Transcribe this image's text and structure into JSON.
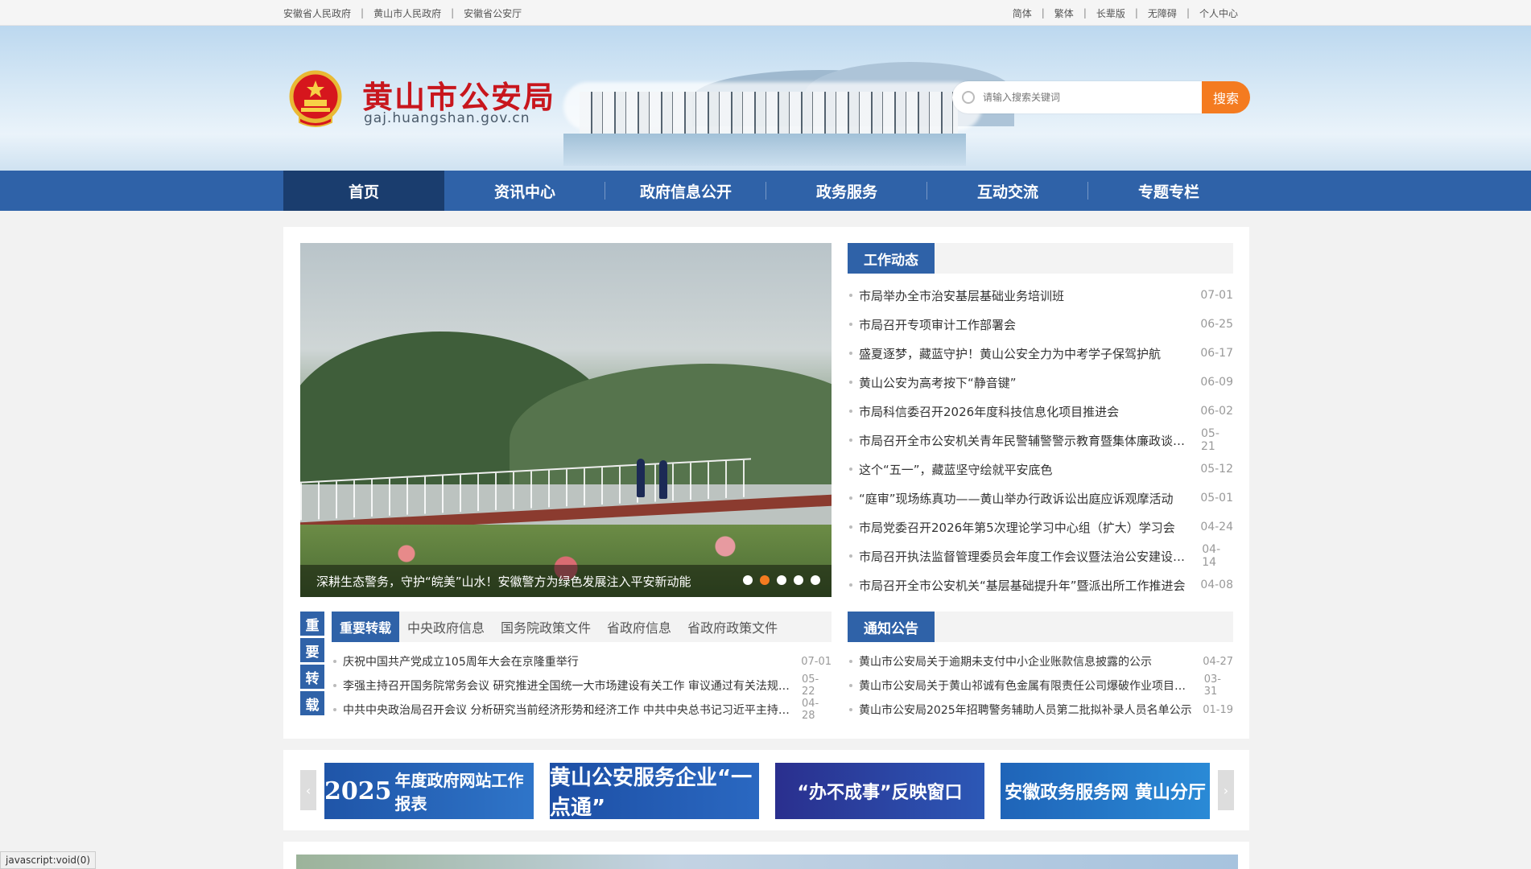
{
  "topbar": {
    "links_left": [
      "安徽省人民政府",
      "黄山市人民政府",
      "安徽省公安厅"
    ],
    "links_right": [
      "简体",
      "繁体",
      "长辈版",
      "无障碍",
      "个人中心"
    ]
  },
  "header": {
    "title": "黄山市公安局",
    "domain": "gaj.huangshan.gov.cn",
    "search_placeholder": "请输入搜索关键词",
    "search_button": "搜索"
  },
  "nav": [
    "首页",
    "资讯中心",
    "政府信息公开",
    "政务服务",
    "互动交流",
    "专题专栏"
  ],
  "slider": {
    "caption": "深耕生态警务，守护“皖美”山水！安徽警方为绿色发展注入平安新动能",
    "dots": 5,
    "active_dot": 1
  },
  "work_news": {
    "tab": "工作动态",
    "items": [
      {
        "title": "市局举办全市治安基层基础业务培训班",
        "date": "07-01"
      },
      {
        "title": "市局召开专项审计工作部署会",
        "date": "06-25"
      },
      {
        "title": "盛夏逐梦，藏蓝守护！黄山公安全力为中考学子保驾护航",
        "date": "06-17"
      },
      {
        "title": "黄山公安为高考按下“静音键”",
        "date": "06-09"
      },
      {
        "title": "市局科信委召开2026年度科技信息化项目推进会",
        "date": "06-02"
      },
      {
        "title": "市局召开全市公安机关青年民警辅警警示教育暨集体廉政谈话会",
        "date": "05-21"
      },
      {
        "title": "这个“五一”，藏蓝坚守绘就平安底色",
        "date": "05-12"
      },
      {
        "title": "“庭审”现场练真功——黄山举办行政诉讼出庭应诉观摩活动",
        "date": "05-01"
      },
      {
        "title": "市局党委召开2026年第5次理论学习中心组（扩大）学习会",
        "date": "04-24"
      },
      {
        "title": "市局召开执法监督管理委员会年度工作会议暨法治公安建设推进会",
        "date": "04-14"
      },
      {
        "title": "市局召开全市公安机关“基层基础提升年”暨派出所工作推进会",
        "date": "04-08"
      }
    ]
  },
  "reprint": {
    "vertical_label": [
      "重",
      "要",
      "转",
      "载"
    ],
    "tabs": [
      "重要转载",
      "中央政府信息",
      "国务院政策文件",
      "省政府信息",
      "省政府政策文件"
    ],
    "items": [
      {
        "title": "庆祝中国共产党成立105周年大会在京隆重举行",
        "date": "07-01"
      },
      {
        "title": "李强主持召开国务院常务会议 研究推进全国统一大市场建设有关工作 审议通过有关法规草案",
        "date": "05-22"
      },
      {
        "title": "中共中央政治局召开会议 分析研究当前经济形势和经济工作 中共中央总书记习近平主持会议",
        "date": "04-28"
      }
    ]
  },
  "notices": {
    "tab": "通知公告",
    "items": [
      {
        "title": "黄山市公安局关于逾期未支付中小企业账款信息披露的公示",
        "date": "04-27"
      },
      {
        "title": "黄山市公安局关于黄山祁诚有色金属有限责任公司爆破作业项目的公示",
        "date": "03-31"
      },
      {
        "title": "黄山市公安局2025年招聘警务辅助人员第二批拟补录人员名单公示",
        "date": "01-19"
      }
    ]
  },
  "banners": [
    {
      "year": "2025",
      "text": "年度政府网站工作报表"
    },
    {
      "text": "黄山公安服务企业“一点通”"
    },
    {
      "text": "“办不成事”反映窗口"
    },
    {
      "text": "安徽政务服务网 黄山分厅"
    }
  ],
  "status_bar": "javascript:void(0)",
  "colors": {
    "primary": "#2f62a8",
    "nav_active": "#1a3d6e",
    "accent": "#f47b20",
    "title_red": "#c8161d"
  }
}
